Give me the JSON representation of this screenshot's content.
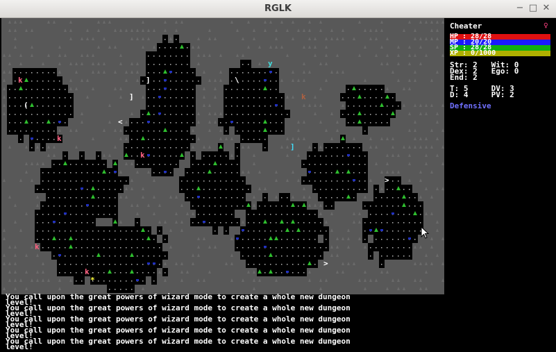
{
  "window": {
    "title": "RGLK",
    "minimize_glyph": "−",
    "maximize_glyph": "□",
    "close_glyph": "✕"
  },
  "colors": {
    "floor_dot": "#b8b8b8",
    "wall": "#6a6a6a",
    "tree": "#2fbf2f",
    "monster_k": "#ff6080",
    "hp": "#ff2020",
    "mp": "#2020ff",
    "sp": "#20c020",
    "xp": "#c0c000",
    "stance": "#8080ff",
    "gender": "#ff4080"
  },
  "sidebar": {
    "name": "Cheater",
    "gender_symbol": "♀",
    "bars": [
      {
        "label": "HP : 28/28",
        "color": "#e01010",
        "fill": 1.0
      },
      {
        "label": "MP : 20/20",
        "color": "#1a1aff",
        "fill": 1.0
      },
      {
        "label": "SP : 28/28",
        "color": "#10b010",
        "fill": 1.0
      },
      {
        "label": "XP : 0/1000",
        "color": "#b0b000",
        "fill": 1.0
      }
    ],
    "stats": [
      "Str: 2   Wit: 0",
      "Dex: 2   Ego: 0",
      "End: 2"
    ],
    "combat": [
      "T: 5     DV: 3",
      "D: 4     PV: 2"
    ],
    "stance": "Defensive"
  },
  "messages": [
    {
      "line1": "You call upon the great powers of wizard mode to create a whole new dungeon",
      "line2": "level!"
    },
    {
      "line1": "You call upon the great powers of wizard mode to create a whole new dungeon",
      "line2": "level!"
    },
    {
      "line1": "You call upon the great powers of wizard mode to create a whole new dungeon",
      "line2": "level!"
    },
    {
      "line1": "You call upon the great powers of wizard mode to create a whole new dungeon",
      "line2": "level!"
    },
    {
      "line1": "You call upon the great powers of wizard mode to create a whole new dungeon",
      "line2": "level!"
    }
  ],
  "map_glyphs": [
    {
      "ch": "k",
      "color": "#ff6080",
      "col": 3,
      "row": 7
    },
    {
      "ch": "k",
      "color": "#ff6080",
      "col": 10,
      "row": 14
    },
    {
      "ch": "k",
      "color": "#ff6080",
      "col": 25,
      "row": 16
    },
    {
      "ch": "k",
      "color": "#ff6080",
      "col": 6,
      "row": 27
    },
    {
      "ch": "k",
      "color": "#ff6080",
      "col": 15,
      "row": 30
    },
    {
      "ch": "k",
      "color": "#b06040",
      "col": 54,
      "row": 9
    },
    {
      "ch": "y",
      "color": "#40e0e0",
      "col": 48,
      "row": 5
    },
    {
      "ch": "]",
      "color": "#ffffff",
      "col": 26,
      "row": 7
    },
    {
      "ch": "]",
      "color": "#ffffff",
      "col": 23,
      "row": 9
    },
    {
      "ch": "]",
      "color": "#40e0ff",
      "col": 52,
      "row": 15
    },
    {
      "ch": "(",
      "color": "#ffffff",
      "col": 4,
      "row": 10
    },
    {
      "ch": "<",
      "color": "#ffffff",
      "col": 21,
      "row": 12
    },
    {
      "ch": ">",
      "color": "#ffffff",
      "col": 69,
      "row": 19
    },
    {
      "ch": ">",
      "color": "#ffffff",
      "col": 58,
      "row": 29
    },
    {
      "ch": ">",
      "color": "#ffffff",
      "col": 16,
      "row": 34
    },
    {
      "ch": "*",
      "color": "#ffff40",
      "col": 16,
      "row": 31
    },
    {
      "ch": "\\",
      "color": "#ffffff",
      "col": 42,
      "row": 7
    }
  ]
}
